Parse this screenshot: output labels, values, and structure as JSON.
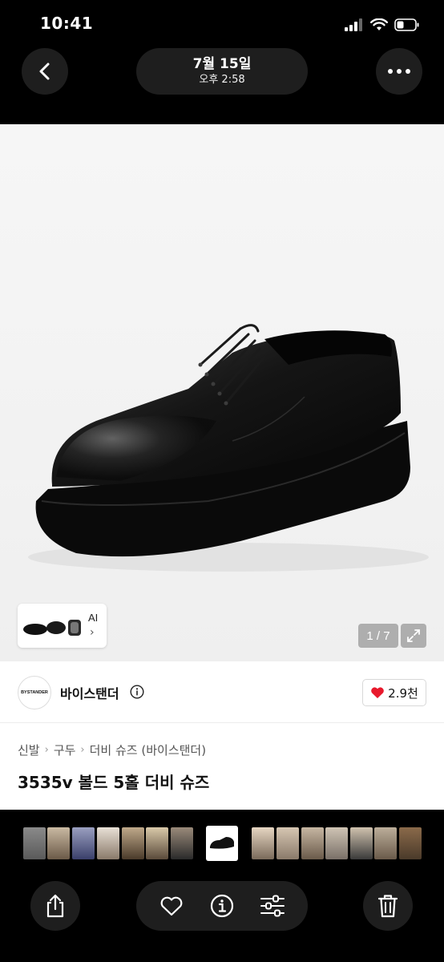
{
  "status_bar": {
    "time": "10:41"
  },
  "header": {
    "date": "7월 15일",
    "time": "오후 2:58"
  },
  "screenshot": {
    "thumbnail_label": "AI",
    "page_indicator": "1 / 7",
    "brand": {
      "name": "바이스탠더",
      "logo_text": "BYSTANDER"
    },
    "likes": "2.9천",
    "breadcrumb": [
      "신발",
      "구두",
      "더비 슈즈 (바이스탠더)"
    ],
    "product_title": "3535v 볼드 5홀 더비 슈즈"
  },
  "colors": {
    "heart": "#e8192c",
    "toolbar_bg": "#1e1e1e"
  },
  "toolbar": {
    "share_icon": "share-icon",
    "favorite_icon": "heart-icon",
    "info_icon": "info-icon",
    "adjust_icon": "sliders-icon",
    "delete_icon": "trash-icon"
  }
}
